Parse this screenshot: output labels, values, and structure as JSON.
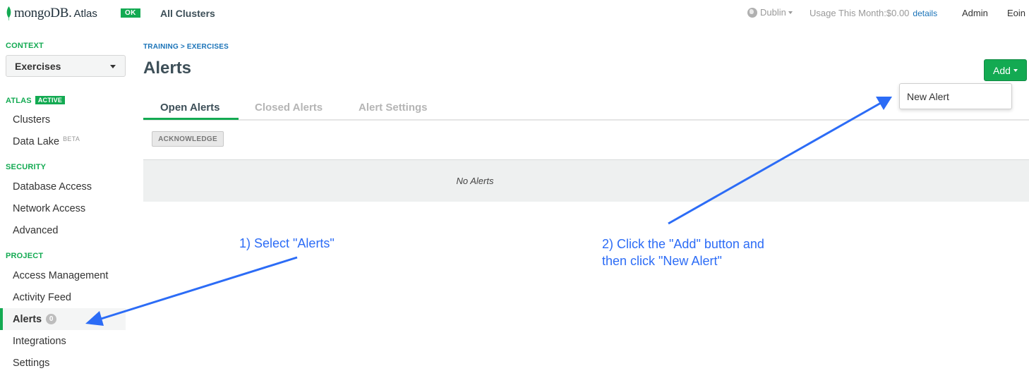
{
  "topbar": {
    "logo_text": "mongoDB.",
    "logo_sub": "Atlas",
    "status_badge": "OK",
    "clusters_link": "All Clusters",
    "region": "Dublin",
    "usage_label": "Usage This Month:$0.00",
    "usage_details": "details",
    "admin": "Admin",
    "user": "Eoin"
  },
  "sidebar": {
    "context_heading": "CONTEXT",
    "context_value": "Exercises",
    "atlas_heading": "ATLAS",
    "atlas_badge": "ACTIVE",
    "atlas_items": [
      {
        "label": "Clusters"
      },
      {
        "label": "Data Lake",
        "tag": "BETA"
      }
    ],
    "security_heading": "SECURITY",
    "security_items": [
      {
        "label": "Database Access"
      },
      {
        "label": "Network Access"
      },
      {
        "label": "Advanced"
      }
    ],
    "project_heading": "PROJECT",
    "project_items": [
      {
        "label": "Access Management"
      },
      {
        "label": "Activity Feed"
      },
      {
        "label": "Alerts",
        "count": "0"
      },
      {
        "label": "Integrations"
      },
      {
        "label": "Settings"
      }
    ]
  },
  "main": {
    "breadcrumb": "TRAINING > EXERCISES",
    "title": "Alerts",
    "add_button": "Add",
    "dropdown_item": "New Alert",
    "tabs": [
      {
        "label": "Open Alerts"
      },
      {
        "label": "Closed Alerts"
      },
      {
        "label": "Alert Settings"
      }
    ],
    "acknowledge": "ACKNOWLEDGE",
    "empty_message": "No Alerts"
  },
  "annotations": {
    "step1": "1) Select \"Alerts\"",
    "step2_line1": "2) Click the \"Add\" button and",
    "step2_line2": "then click \"New Alert\"",
    "color": "#2c6cf6"
  },
  "colors": {
    "brand_green": "#13aa52",
    "link_blue": "#1a73b8"
  }
}
